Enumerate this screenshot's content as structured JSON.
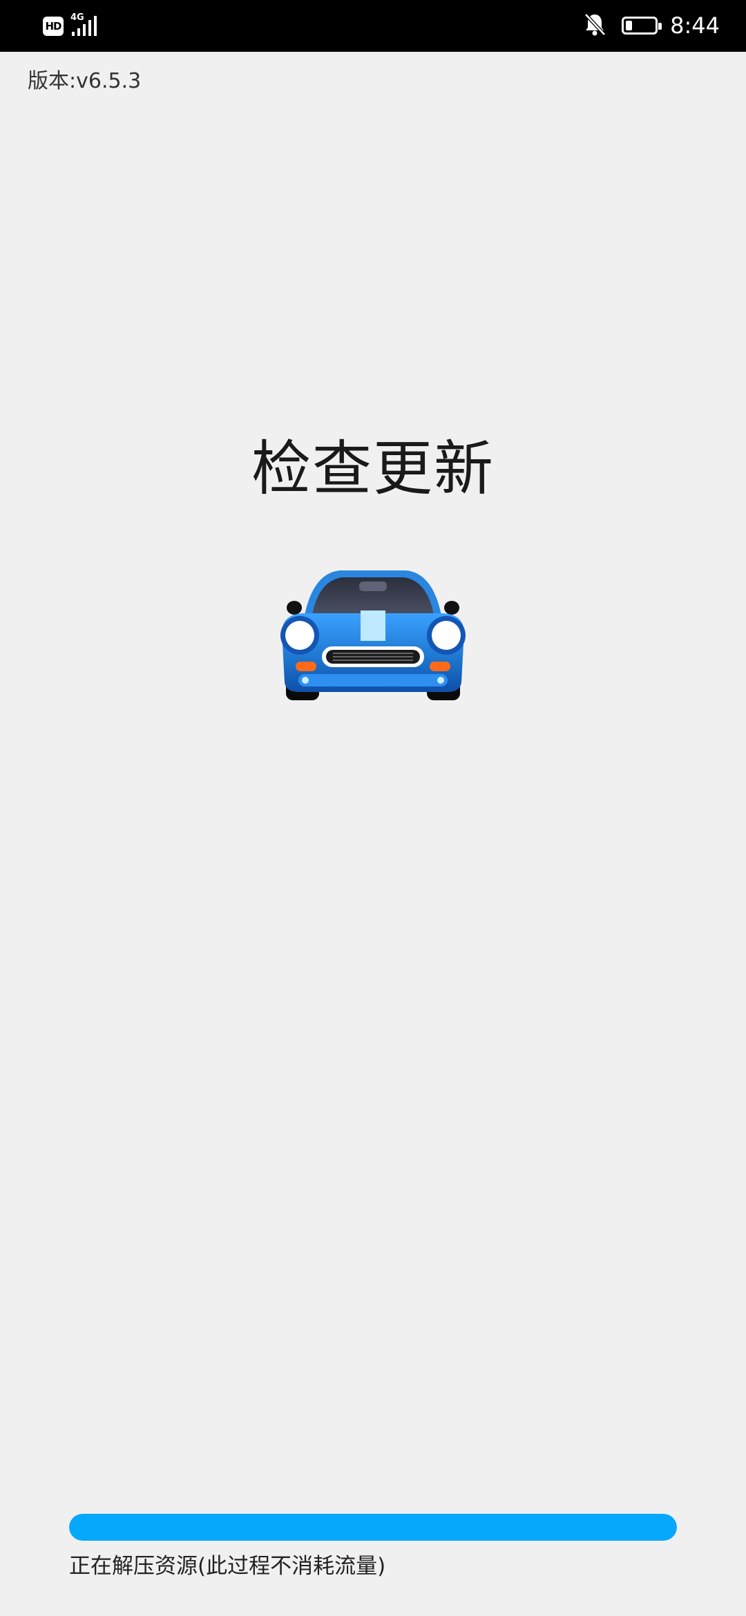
{
  "status_bar": {
    "hd_badge": "HD",
    "network": "4G",
    "time": "8:44",
    "battery_level": 0.25,
    "icons": [
      "hd-icon",
      "signal-icon",
      "bell-off-icon",
      "battery-icon"
    ]
  },
  "app": {
    "version_label": "版本:v6.5.3",
    "title": "检查更新",
    "car_icon": "car-icon",
    "progress": {
      "value": 1.0,
      "label": "正在解压资源(此过程不消耗流量)"
    }
  },
  "colors": {
    "progress_fill": "#06a8fb",
    "background": "#f0f0f0",
    "car_body": "#1f78d1"
  }
}
